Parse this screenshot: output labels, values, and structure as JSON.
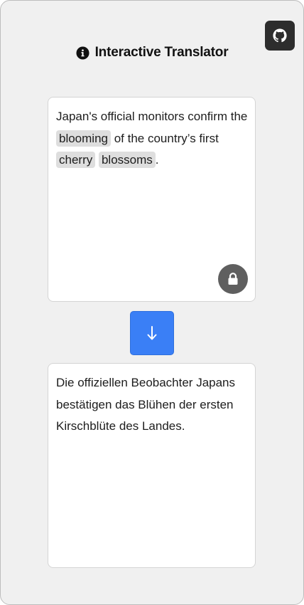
{
  "header": {
    "title": "Interactive Translator",
    "info_icon": "info-circle-icon",
    "github_icon": "github-icon"
  },
  "source": {
    "parts": [
      {
        "text": "Japan's official monitors confirm the ",
        "chip": false
      },
      {
        "text": "blooming",
        "chip": true
      },
      {
        "text": " of the country’s first ",
        "chip": false
      },
      {
        "text": "cherry",
        "chip": true
      },
      {
        "text": " ",
        "chip": false
      },
      {
        "text": "blossoms",
        "chip": true
      },
      {
        "text": ".",
        "chip": false
      }
    ],
    "lock_icon": "lock-icon"
  },
  "translate_button": {
    "icon": "arrow-down-icon"
  },
  "target": {
    "text": "Die offiziellen Beobachter Japans bestätigen das Blühen der ersten Kirschblüte des Landes."
  },
  "colors": {
    "background": "#f0f0f0",
    "accent": "#3a7ff6",
    "chip": "#dedede",
    "github_button": "#2d2d2d",
    "lock_button": "#5f5f5f"
  }
}
